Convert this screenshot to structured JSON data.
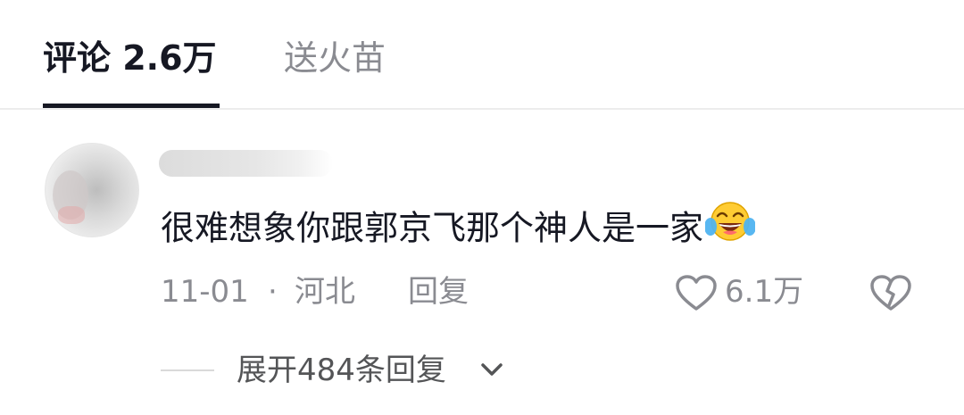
{
  "tabs": {
    "comments_label": "评论 2.6万",
    "gift_label": "送火苗"
  },
  "comment": {
    "text": "很难想象你跟郭京飞那个神人是一家",
    "emoji": "laughing-with-tears-emoji",
    "date": "11-01",
    "separator": "·",
    "region": "河北",
    "reply_label": "回复",
    "like_count": "6.1万",
    "expand_label": "展开484条回复"
  },
  "icons": {
    "like": "heart-outline-icon",
    "dislike": "broken-heart-icon",
    "expand": "chevron-down-icon"
  },
  "colors": {
    "primary_text": "#161823",
    "secondary_text": "#8a8b91",
    "divider": "#ececec"
  }
}
